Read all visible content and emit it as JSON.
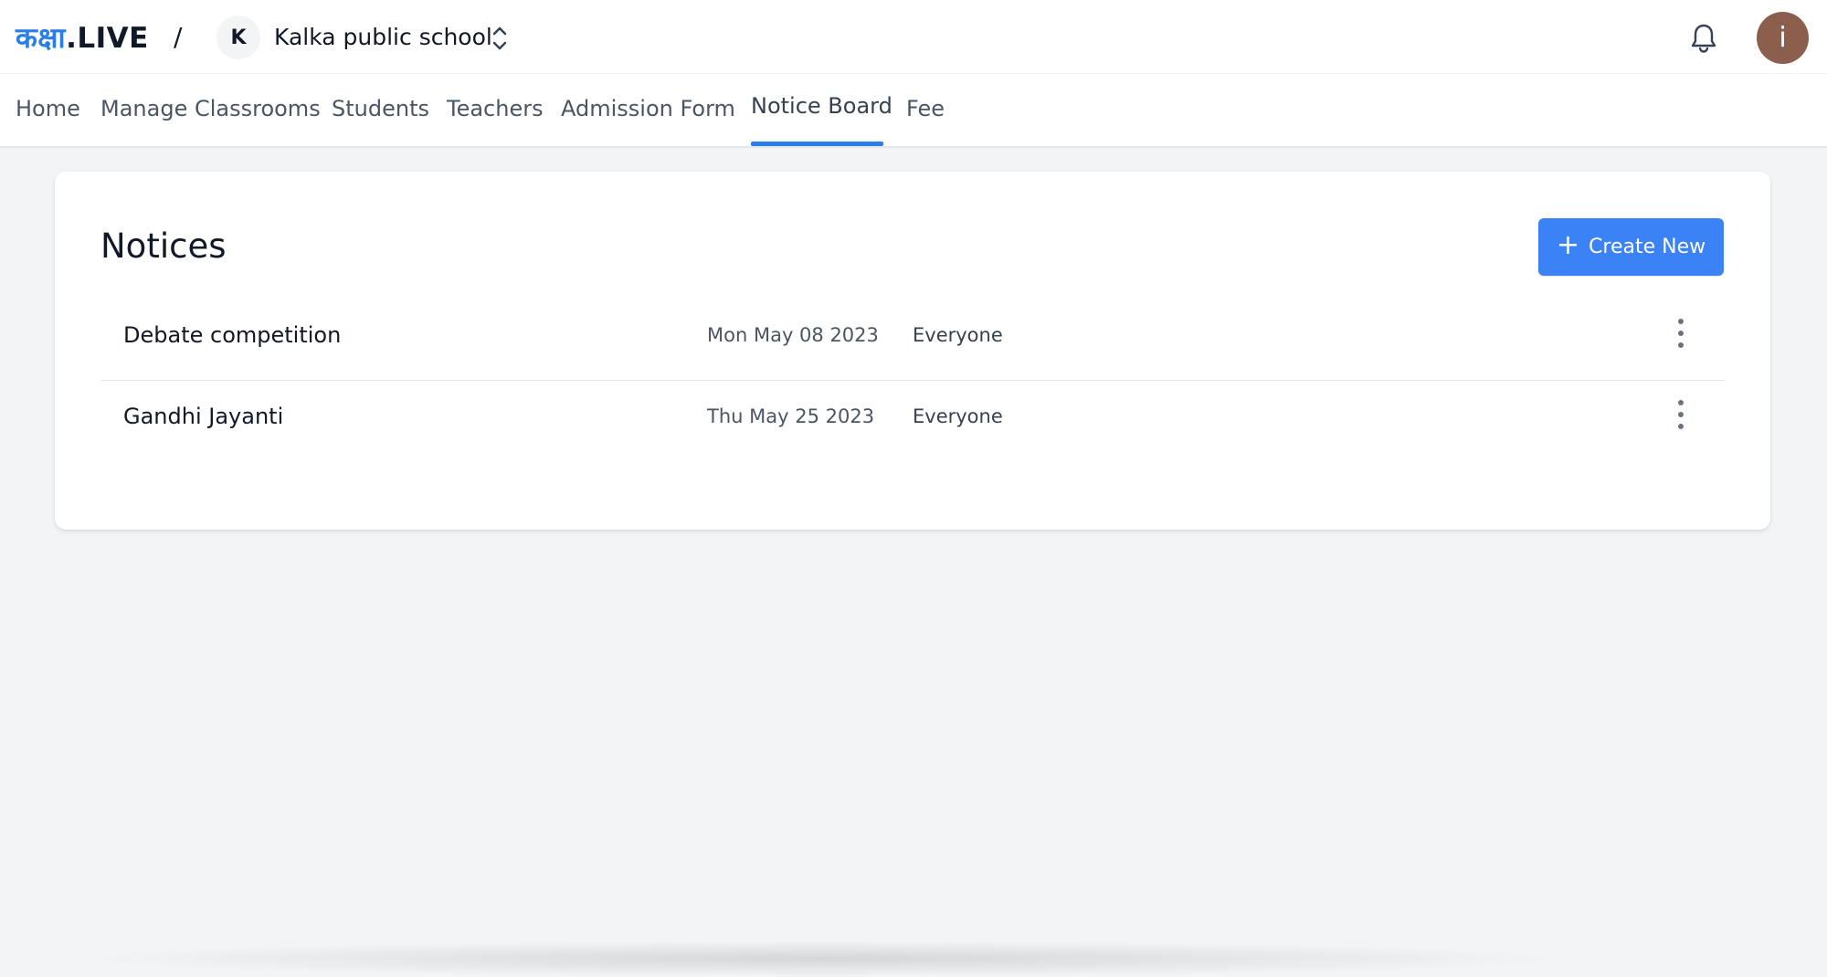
{
  "brand": {
    "logo_hindi": "कक्षा",
    "logo_suffix": ".LIVE",
    "separator": "/"
  },
  "school": {
    "initial": "K",
    "name": "Kalka public school",
    "switcher_icon": "chevron-up-down-icon"
  },
  "header": {
    "notifications_icon": "bell-icon",
    "user_initial": "i",
    "user_avatar_color": "#8b5e4d"
  },
  "nav": {
    "items": [
      {
        "label": "Home"
      },
      {
        "label": "Manage Classrooms"
      },
      {
        "label": "Students"
      },
      {
        "label": "Teachers"
      },
      {
        "label": "Admission Form"
      },
      {
        "label": "Notice Board",
        "active": true
      },
      {
        "label": "Fee"
      }
    ],
    "accent": "#2b7de9"
  },
  "notices": {
    "title": "Notices",
    "create_button": {
      "label": "Create New",
      "icon": "plus-icon",
      "color": "#3b82f6"
    },
    "rows": [
      {
        "title": "Debate competition",
        "date": "Mon May 08 2023",
        "audience": "Everyone",
        "menu_icon": "more-vertical-icon"
      },
      {
        "title": "Gandhi Jayanti",
        "date": "Thu May 25 2023",
        "audience": "Everyone",
        "menu_icon": "more-vertical-icon"
      }
    ]
  }
}
